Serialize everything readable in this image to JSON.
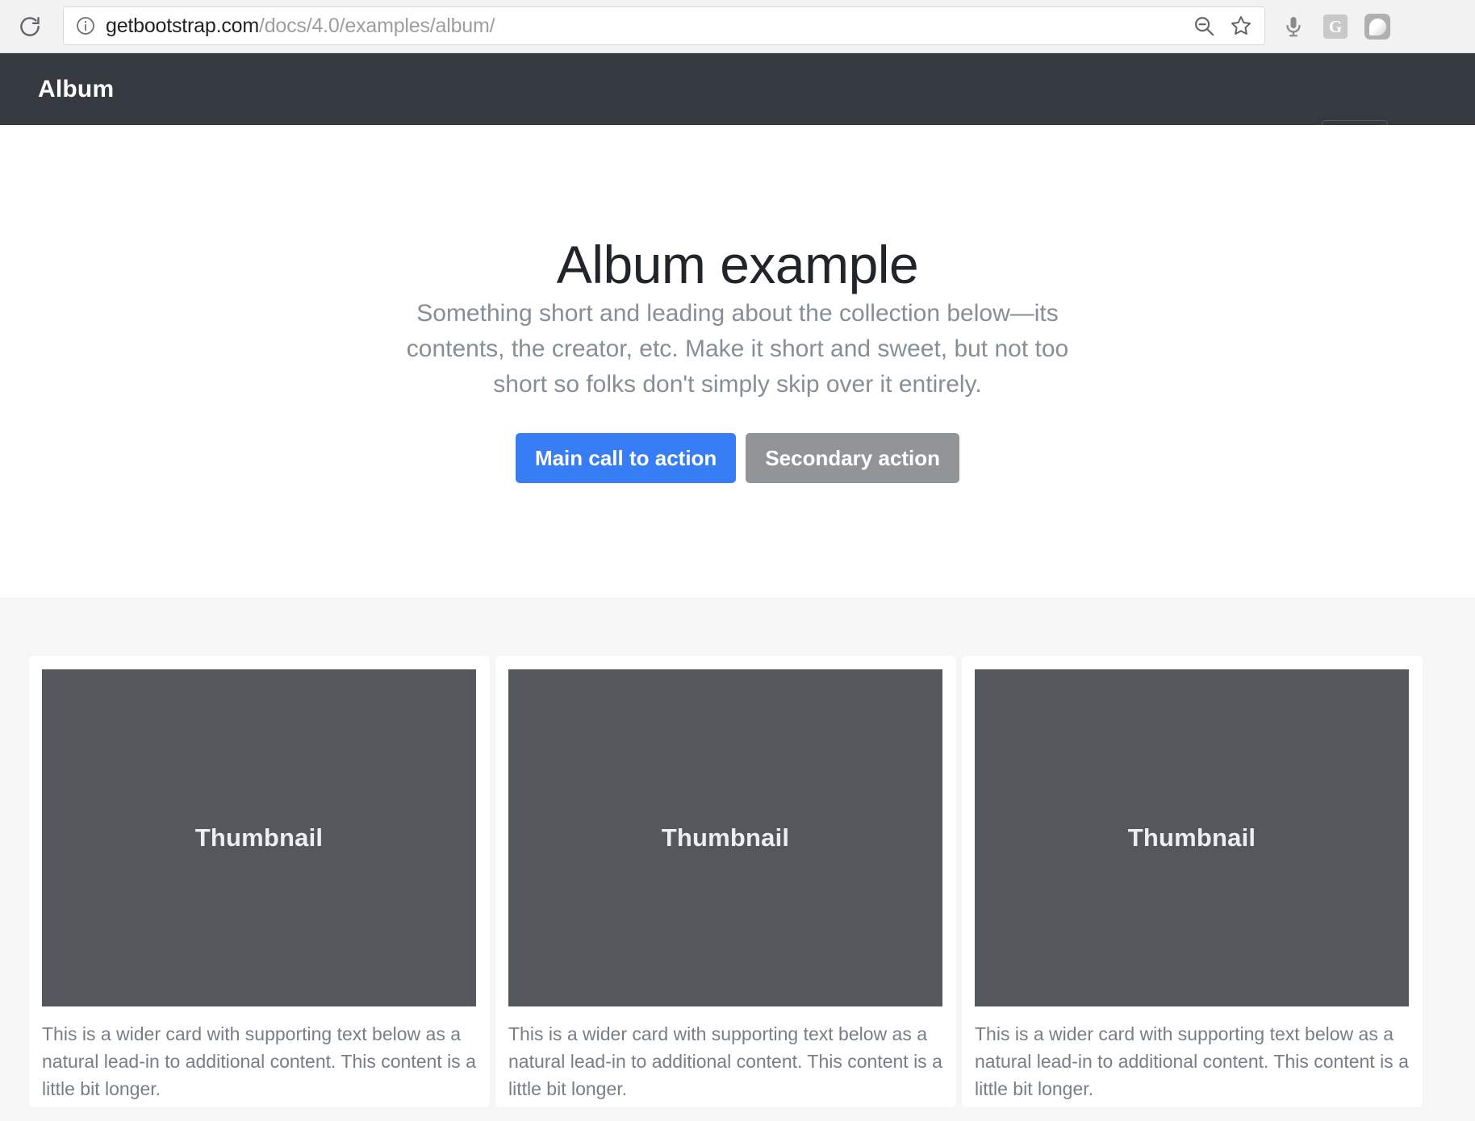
{
  "browser": {
    "reload_icon": "reload-icon",
    "info_icon": "info-circle-icon",
    "url_host": "getbootstrap.com",
    "url_path": "/docs/4.0/examples/album/",
    "url_full": "getbootstrap.com/docs/4.0/examples/album/",
    "zoom_out_icon": "zoom-out-magnifier-icon",
    "bookmark_icon": "star-outline-icon",
    "extensions": [
      {
        "name": "microphone-icon",
        "label": ""
      },
      {
        "name": "grammarly-extension-icon",
        "label": "G"
      },
      {
        "name": "ghostery-extension-icon",
        "label": ""
      }
    ]
  },
  "navbar": {
    "brand": "Album",
    "toggler_icon": "hamburger-menu-icon"
  },
  "hero": {
    "title": "Album example",
    "lead": "Something short and leading about the collection below—its contents, the creator, etc. Make it short and sweet, but not too short so folks don't simply skip over it entirely.",
    "primary_button": "Main call to action",
    "secondary_button": "Secondary action",
    "primary_color": "#377ef6",
    "secondary_color": "#919598"
  },
  "album": {
    "background": "#f6f6f6",
    "thumb_color": "#54585c",
    "cards": [
      {
        "thumb_label": "Thumbnail",
        "text": "This is a wider card with supporting text below as a natural lead-in to additional content. This content is a little bit longer."
      },
      {
        "thumb_label": "Thumbnail",
        "text": "This is a wider card with supporting text below as a natural lead-in to additional content. This content is a little bit longer."
      },
      {
        "thumb_label": "Thumbnail",
        "text": "This is a wider card with supporting text below as a natural lead-in to additional content. This content is a little bit longer."
      }
    ]
  }
}
